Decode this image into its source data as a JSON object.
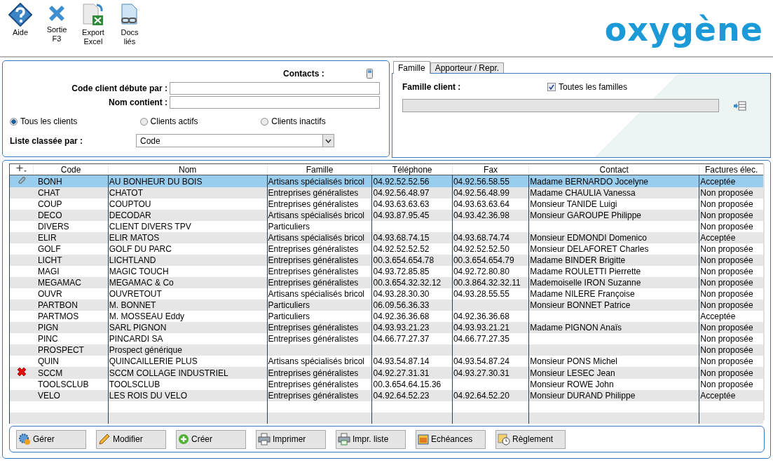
{
  "toolbar": [
    {
      "kind": "help",
      "label": "Aide"
    },
    {
      "kind": "exit",
      "label": "Sortie\nF3"
    },
    {
      "kind": "excel",
      "label": "Export\nExcel"
    },
    {
      "kind": "docs",
      "label": "Docs\nliés"
    }
  ],
  "logo": "oxygène",
  "filters": {
    "contacts_label": "Contacts :",
    "code_label": "Code client débute par :",
    "nom_label": "Nom contient :",
    "radios": [
      {
        "label": "Tous les clients",
        "selected": true
      },
      {
        "label": "Clients actifs",
        "selected": false
      },
      {
        "label": "Clients inactifs",
        "selected": false
      }
    ],
    "sort_label": "Liste classée par :",
    "sort_value": "Code"
  },
  "tabs": [
    {
      "label": "Famille",
      "selected": true
    },
    {
      "label": "Apporteur / Repr.",
      "selected": false
    }
  ],
  "famille": {
    "label": "Famille client :",
    "all_label": "Toutes les familles",
    "all_checked": true
  },
  "table": {
    "columns": [
      "Code",
      "Nom",
      "Famille",
      "Téléphone",
      "Fax",
      "Contact",
      "Factures élec."
    ],
    "rows": [
      {
        "kind": "attachment",
        "selected": true,
        "cells": [
          "BONH",
          "AU BONHEUR DU BOIS",
          "Artisans spécialisés bricol",
          "04.92.52.52.56",
          "04.92.56.58.55",
          "Madame BERNARDO Jocelyne",
          "Acceptée"
        ]
      },
      {
        "kind": "plain",
        "selected": false,
        "cells": [
          "CHAT",
          "CHATOT",
          "Entreprises généralistes",
          "04.92.56.48.97",
          "04.92.56.48.99",
          "Madame CHAULIA Vanessa",
          "Non proposée"
        ]
      },
      {
        "kind": "plain",
        "selected": false,
        "cells": [
          "COUP",
          "COUPTOU",
          "Entreprises généralistes",
          "04.93.63.63.63",
          "04.93.63.63.64",
          "Monsieur TANIDE Luigi",
          "Non proposée"
        ]
      },
      {
        "kind": "plain",
        "selected": false,
        "cells": [
          "DECO",
          "DECODAR",
          "Artisans spécialisés bricol",
          "04.93.87.95.45",
          "04.93.42.36.98",
          "Monsieur GAROUPE Philippe",
          "Non proposée"
        ]
      },
      {
        "kind": "plain",
        "selected": false,
        "cells": [
          "DIVERS",
          "CLIENT DIVERS TPV",
          "Particuliers",
          "",
          "",
          "",
          "Non proposée"
        ]
      },
      {
        "kind": "plain",
        "selected": false,
        "cells": [
          "ELIR",
          "ELIR MATOS",
          "Artisans spécialisés bricol",
          "04.93.68.74.15",
          "04.93.68.74.74",
          "Monsieur EDMONDI Domenico",
          "Acceptée"
        ]
      },
      {
        "kind": "plain",
        "selected": false,
        "cells": [
          "GOLF",
          "GOLF DU PARC",
          "Entreprises généralistes",
          "04.92.52.52.52",
          "04.92.52.52.50",
          "Monsieur DELAFORET Charles",
          "Non proposée"
        ]
      },
      {
        "kind": "plain",
        "selected": false,
        "cells": [
          "LICHT",
          "LICHTLAND",
          "Entreprises généralistes",
          "00.3.654.654.78",
          "00.3.654.654.79",
          "Madame BINDER Brigitte",
          "Non proposée"
        ]
      },
      {
        "kind": "plain",
        "selected": false,
        "cells": [
          "MAGI",
          "MAGIC TOUCH",
          "Entreprises généralistes",
          "04.93.72.85.85",
          "04.92.72.80.80",
          "Madame ROULETTI Pierrette",
          "Non proposée"
        ]
      },
      {
        "kind": "plain",
        "selected": false,
        "cells": [
          "MEGAMAC",
          "MEGAMAC & Co",
          "Entreprises généralistes",
          "00.3.654.32.32.12",
          "00.3.864.32.32.11",
          "Mademoiselle IRON Suzanne",
          "Non proposée"
        ]
      },
      {
        "kind": "plain",
        "selected": false,
        "cells": [
          "OUVR",
          "OUVRETOUT",
          "Artisans spécialisés bricol",
          "04.93.28.30.30",
          "04.93.28.55.55",
          "Madame NILERE Françoise",
          "Non proposée"
        ]
      },
      {
        "kind": "plain",
        "selected": false,
        "cells": [
          "PARTBON",
          "M. BONNET",
          "Particuliers",
          "06.09.56.36.33",
          "",
          "Monsieur BONNET Patrice",
          "Non proposée"
        ]
      },
      {
        "kind": "plain",
        "selected": false,
        "cells": [
          "PARTMOS",
          "M. MOSSEAU Eddy",
          "Particuliers",
          "04.92.36.36.68",
          "04.92.36.36.68",
          "",
          "Acceptée"
        ]
      },
      {
        "kind": "plain",
        "selected": false,
        "cells": [
          "PIGN",
          "SARL PIGNON",
          "Entreprises généralistes",
          "04.93.93.21.23",
          "04.93.93.21.21",
          "Madame PIGNON Anaïs",
          "Non proposée"
        ]
      },
      {
        "kind": "plain",
        "selected": false,
        "cells": [
          "PINC",
          "PINCARDI SA",
          "Entreprises généralistes",
          "04.66.77.27.37",
          "04.66.77.27.35",
          "",
          "Non proposée"
        ]
      },
      {
        "kind": "plain",
        "selected": false,
        "cells": [
          "PROSPECT",
          "Prospect générique",
          "",
          "",
          "",
          "",
          "Non proposée"
        ]
      },
      {
        "kind": "plain",
        "selected": false,
        "cells": [
          "QUIN",
          "QUINCAILLERIE PLUS",
          "Artisans spécialisés bricol",
          "04.93.54.87.14",
          "04.93.54.87.24",
          "Monsieur PONS Michel",
          "Non proposée"
        ]
      },
      {
        "kind": "deleted",
        "selected": false,
        "cells": [
          "SCCM",
          "SCCM COLLAGE INDUSTRIEL",
          "Entreprises généralistes",
          "04.92.27.31.31",
          "04.93.27.30.31",
          "Monsieur LESEC Jean",
          "Non proposée"
        ]
      },
      {
        "kind": "plain",
        "selected": false,
        "cells": [
          "TOOLSCLUB",
          "TOOLSCLUB",
          "Entreprises généralistes",
          "00.3.654.64.15.36",
          "",
          "Monsieur ROWE John",
          "Non proposée"
        ]
      },
      {
        "kind": "plain",
        "selected": false,
        "cells": [
          "VELO",
          "LES ROIS DU VELO",
          "Entreprises généralistes",
          "04.92.64.52.23",
          "04.92.64.52.20",
          "Monsieur DURAND Philippe",
          "Acceptée"
        ]
      }
    ]
  },
  "actions": [
    {
      "kind": "manage",
      "label": "Gérer"
    },
    {
      "kind": "edit",
      "label": "Modifier"
    },
    {
      "kind": "create",
      "label": "Créer"
    },
    {
      "kind": "print",
      "label": "Imprimer"
    },
    {
      "kind": "printlist",
      "label": "Impr. liste"
    },
    {
      "kind": "calendar",
      "label": "Echéances"
    },
    {
      "kind": "payment",
      "label": "Règlement"
    }
  ]
}
